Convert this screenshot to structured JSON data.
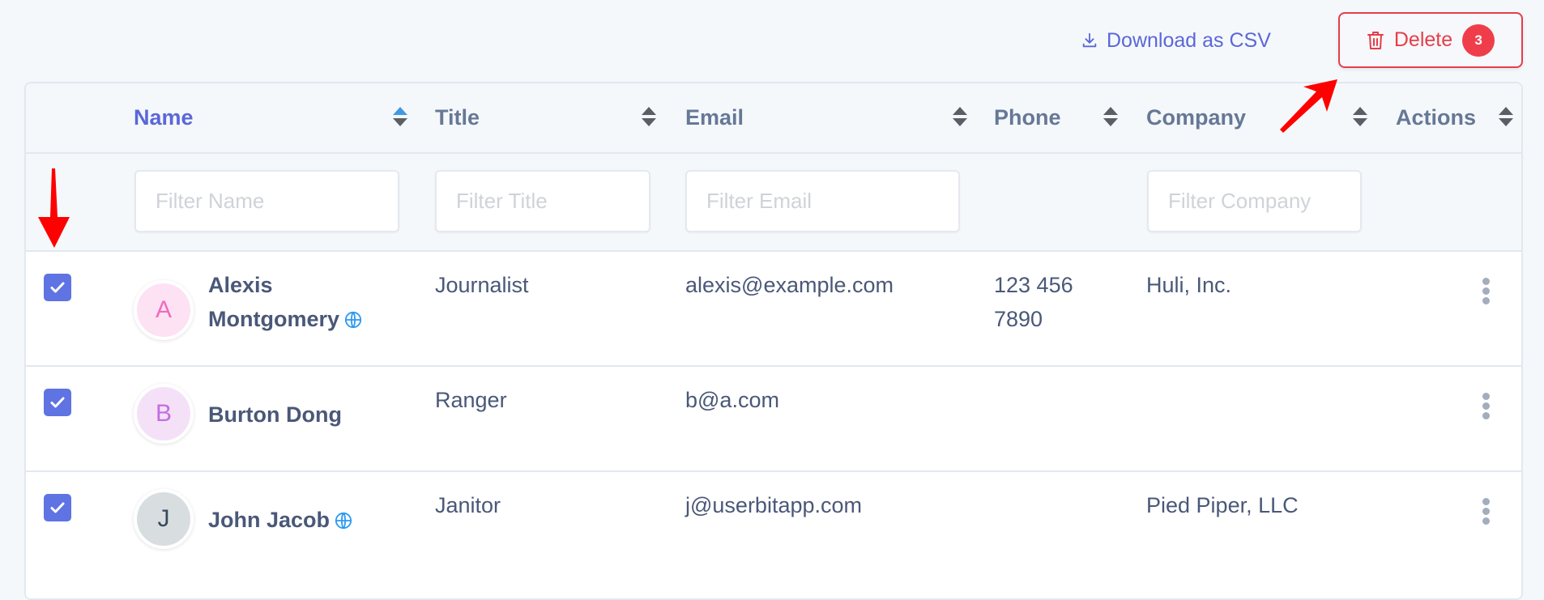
{
  "toolbar": {
    "download_label": "Download as CSV",
    "delete_label": "Delete",
    "delete_count": "3"
  },
  "colors": {
    "accent": "#5a67d8",
    "danger": "#e53e4a",
    "checkbox": "#5f73e3",
    "globe": "#2b9af3",
    "annotation_arrow": "#ff0000"
  },
  "table": {
    "columns": [
      {
        "label": "Name",
        "sort": "ascending",
        "filter_placeholder": "Filter Name"
      },
      {
        "label": "Title",
        "sort": "none",
        "filter_placeholder": "Filter Title"
      },
      {
        "label": "Email",
        "sort": "none",
        "filter_placeholder": "Filter Email"
      },
      {
        "label": "Phone",
        "sort": "none"
      },
      {
        "label": "Company",
        "sort": "none",
        "filter_placeholder": "Filter Company"
      },
      {
        "label": "Actions",
        "sort": "none"
      }
    ],
    "rows": [
      {
        "selected": true,
        "initial": "A",
        "avatar_bg": "#fde2f3",
        "avatar_fg": "#f26bbf",
        "name_line1": "Alexis",
        "name_line2": "Montgomery",
        "has_website": true,
        "title": "Journalist",
        "email": "alexis@example.com",
        "phone_line1": "123 456",
        "phone_line2": "7890",
        "company": "Huli, Inc."
      },
      {
        "selected": true,
        "initial": "B",
        "avatar_bg": "#f4e1f7",
        "avatar_fg": "#c46de0",
        "name": "Burton Dong",
        "has_website": false,
        "title": "Ranger",
        "email": "b@a.com",
        "phone": "",
        "company": ""
      },
      {
        "selected": true,
        "initial": "J",
        "avatar_bg": "#d8dde0",
        "avatar_fg": "#34495e",
        "name": "John Jacob",
        "has_website": true,
        "title": "Janitor",
        "email": "j@userbitapp.com",
        "phone": "",
        "company": "Pied Piper, LLC"
      }
    ]
  }
}
